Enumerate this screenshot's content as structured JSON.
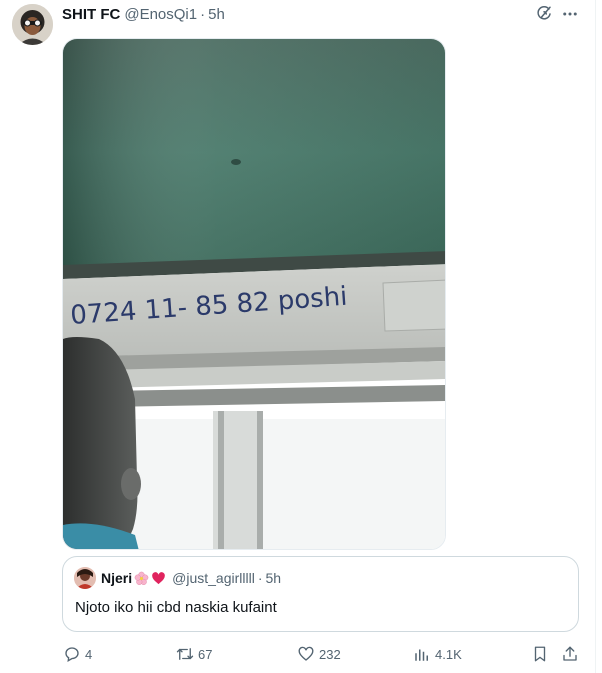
{
  "tweet": {
    "author_name": "SHIT FC",
    "author_handle": "@EnosQi1",
    "separator": "·",
    "time": "5h",
    "avatar_icon": "user-avatar",
    "grok_icon": "grok-icon",
    "more_icon": "more-options-icon"
  },
  "media": {
    "scribble_text": "0724 11- 85 82 poshi"
  },
  "quote": {
    "author_name": "Njeri",
    "emoji_1": "cherry-blossom-emoji",
    "emoji_2": "red-heart-emoji",
    "author_handle": "@just_agirlllll",
    "separator": "·",
    "time": "5h",
    "text": "Njoto iko hii cbd naskia kufaint"
  },
  "actions": {
    "replies": "4",
    "reposts": "67",
    "likes": "232",
    "views": "4.1K"
  },
  "colors": {
    "text_primary": "#0f1419",
    "text_secondary": "#536471",
    "border": "#cfd9de"
  }
}
